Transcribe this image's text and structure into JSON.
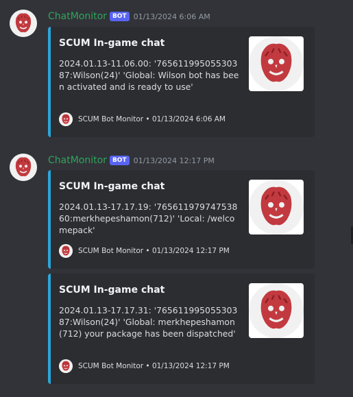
{
  "messages": [
    {
      "username": "ChatMonitor",
      "bot_tag": "BOT",
      "timestamp": "01/13/2024 6:06 AM",
      "embeds": [
        {
          "title": "SCUM In-game chat",
          "description": "2024.01.13-11.06.00: '76561199505530387:Wilson(24)' 'Global: Wilson bot has been activated and is ready to use'",
          "footer": "SCUM Bot Monitor • 01/13/2024 6:06 AM"
        }
      ]
    },
    {
      "username": "ChatMonitor",
      "bot_tag": "BOT",
      "timestamp": "01/13/2024 12:17 PM",
      "embeds": [
        {
          "title": "SCUM In-game chat",
          "description": "2024.01.13-17.17.19: '76561197974753860:merkhepeshamon(712)' 'Local: /welcomepack'",
          "footer": "SCUM Bot Monitor • 01/13/2024 12:17 PM"
        },
        {
          "title": "SCUM In-game chat",
          "description": "2024.01.13-17.17.31: '76561199505530387:Wilson(24)' 'Global: merkhepeshamon(712) your package has been dispatched'",
          "footer": "SCUM Bot Monitor • 01/13/2024 12:17 PM"
        }
      ]
    }
  ],
  "colors": {
    "background": "#313338",
    "embed_background": "#2b2d31",
    "embed_accent": "#2aa7db",
    "username": "#2fa55a",
    "bot_tag": "#5865f2"
  },
  "icons": {
    "avatar": "wilson-volleyball-avatar",
    "thumbnail": "wilson-volleyball-thumbnail",
    "footer_icon": "wilson-volleyball-footer-icon"
  }
}
